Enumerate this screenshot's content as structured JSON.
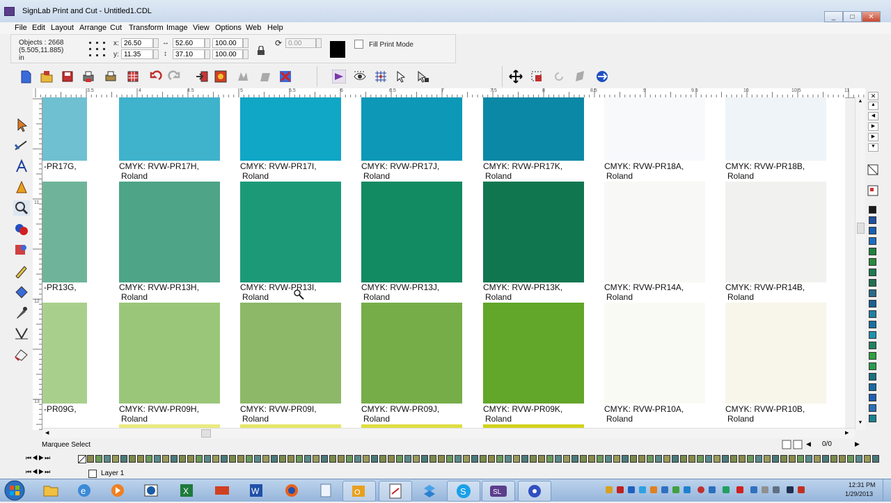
{
  "window": {
    "title": "SignLab Print and Cut - Untitled1.CDL",
    "controls": [
      "_",
      "□",
      "✕"
    ]
  },
  "menu": [
    "File",
    "Edit",
    "Layout",
    "Arrange",
    "Cut",
    "Transform",
    "Image",
    "View",
    "Options",
    "Web",
    "Help"
  ],
  "properties": {
    "objects": "Objects : 2668",
    "coords": "(5.505,11.885)",
    "units": "in",
    "x_label": "x:",
    "x_value": "26.50",
    "y_label": "y:",
    "y_value": "11.35",
    "w_value": "52.60",
    "h_value": "37.10",
    "scale_x": "100.00",
    "scale_y": "100.00",
    "angle": "0.00",
    "fill_print_mode": "Fill Print Mode"
  },
  "ruler": {
    "h_labels": [
      "3.5",
      "4",
      "4.5",
      "5",
      "5.5",
      "6",
      "6.5",
      "7",
      "7.5",
      "8",
      "8.5",
      "9",
      "9.5",
      "10",
      "10.5",
      "11"
    ],
    "v_labels": [
      "11",
      "12",
      "13"
    ]
  },
  "swatches": {
    "rows": [
      {
        "items": [
          {
            "label1": "-PR17G,",
            "label2": "",
            "color": "#6fc0d0"
          },
          {
            "label1": "CMYK: RVW-PR17H,",
            "label2": "Roland",
            "color": "#3fb2cc"
          },
          {
            "label1": "CMYK: RVW-PR17I,",
            "label2": "Roland",
            "color": "#10a6c6"
          },
          {
            "label1": "CMYK: RVW-PR17J,",
            "label2": "Roland",
            "color": "#0d98b8"
          },
          {
            "label1": "CMYK: RVW-PR17K,",
            "label2": "Roland",
            "color": "#0b88a6"
          },
          {
            "label1": "CMYK: RVW-PR18A,",
            "label2": "Roland",
            "color": "#f7f9fb"
          },
          {
            "label1": "CMYK: RVW-PR18B,",
            "label2": "Roland",
            "color": "#eef4f7"
          },
          {
            "label1": "C",
            "label2": "R",
            "color": "#ffffff"
          }
        ]
      },
      {
        "items": [
          {
            "label1": "-PR13G,",
            "label2": "",
            "color": "#6fb49a"
          },
          {
            "label1": "CMYK: RVW-PR13H,",
            "label2": "Roland",
            "color": "#4da486"
          },
          {
            "label1": "CMYK: RVW-PR13I,",
            "label2": "Roland",
            "color": "#1c9a78"
          },
          {
            "label1": "CMYK: RVW-PR13J,",
            "label2": "Roland",
            "color": "#128a62"
          },
          {
            "label1": "CMYK: RVW-PR13K,",
            "label2": "Roland",
            "color": "#107650"
          },
          {
            "label1": "CMYK: RVW-PR14A,",
            "label2": "Roland",
            "color": "#f8f8f6"
          },
          {
            "label1": "CMYK: RVW-PR14B,",
            "label2": "Roland",
            "color": "#f1f1ef"
          },
          {
            "label1": "Cl",
            "label2": "R",
            "color": "#ffffff"
          }
        ]
      },
      {
        "items": [
          {
            "label1": "-PR09G,",
            "label2": "",
            "color": "#a9cf8d"
          },
          {
            "label1": "CMYK: RVW-PR09H,",
            "label2": "Roland",
            "color": "#9ac679"
          },
          {
            "label1": "CMYK: RVW-PR09I,",
            "label2": "Roland",
            "color": "#8cb868"
          },
          {
            "label1": "CMYK: RVW-PR09J,",
            "label2": "Roland",
            "color": "#76ad48"
          },
          {
            "label1": "CMYK: RVW-PR09K,",
            "label2": "Roland",
            "color": "#62a62a"
          },
          {
            "label1": "CMYK: RVW-PR10A,",
            "label2": "Roland",
            "color": "#fafaf4"
          },
          {
            "label1": "CMYK: RVW-PR10B,",
            "label2": "Roland",
            "color": "#f8f5ea"
          },
          {
            "label1": "C",
            "label2": "R",
            "color": "#ffffff"
          }
        ]
      }
    ]
  },
  "status": {
    "mode": "Marquee Select",
    "page": "0/0"
  },
  "layer": {
    "name": "Layer 1"
  },
  "clock": {
    "time": "12:31 PM",
    "date": "1/29/2013"
  },
  "taskbar_apps": [
    "explorer-icon",
    "ie-icon",
    "media-player-icon",
    "hp-icon",
    "excel-icon",
    "powerpoint-icon",
    "word-icon",
    "firefox-icon",
    "notepad-icon",
    "outlook-icon",
    "acrobat-icon",
    "dropbox-icon",
    "skype-icon",
    "signlab-icon",
    "flower-icon"
  ],
  "taskbar_labels": {
    "signlab": "SL"
  }
}
